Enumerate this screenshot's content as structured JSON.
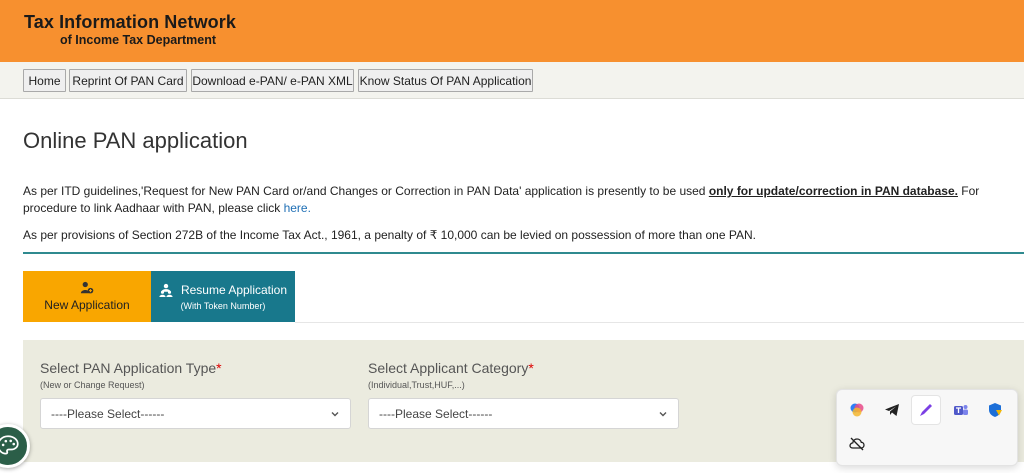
{
  "header": {
    "title": "Tax Information Network",
    "subtitle": "of Income Tax Department"
  },
  "nav": {
    "home": "Home",
    "reprint": "Reprint Of PAN Card",
    "download": "Download e-PAN/ e-PAN XML",
    "status": "Know Status Of PAN Application"
  },
  "main": {
    "page_title": "Online PAN application",
    "notice1": {
      "text_before": "As per ITD guidelines,'Request for New PAN Card or/and Changes or Correction in PAN Data' application is presently to be used ",
      "emphasis": "only for update/correction in PAN database.",
      "text_after": " For procedure to link Aadhaar with PAN, please click ",
      "link": "here."
    },
    "notice2": "As per provisions of Section 272B of the Income Tax Act., 1961, a penalty of ₹ 10,000 can be levied on possession of more than one PAN."
  },
  "tabs": {
    "new_application": "New Application",
    "resume_application": "Resume Application",
    "resume_sub": "(With Token Number)"
  },
  "form": {
    "type_label": "Select PAN Application Type",
    "type_hint": "(New or Change Request)",
    "type_value": "----Please Select------",
    "category_label": "Select Applicant Category",
    "category_hint": "(Individual,Trust,HUF,...)",
    "category_value": "----Please Select------",
    "required_mark": "*"
  },
  "colors": {
    "header_bg": "#f7902f",
    "new_tab_bg": "#f9a600",
    "resume_tab_bg": "#18788c",
    "form_panel_bg": "#ebebdf",
    "rule": "#2f8a8f"
  },
  "icons": {
    "new_application": "person-add-icon",
    "resume_application": "people-icon",
    "fab": "palette-icon",
    "tray": [
      "copilot-icon",
      "telegram-icon",
      "pen-icon",
      "teams-icon",
      "defender-icon",
      "cloud-off-icon"
    ]
  }
}
